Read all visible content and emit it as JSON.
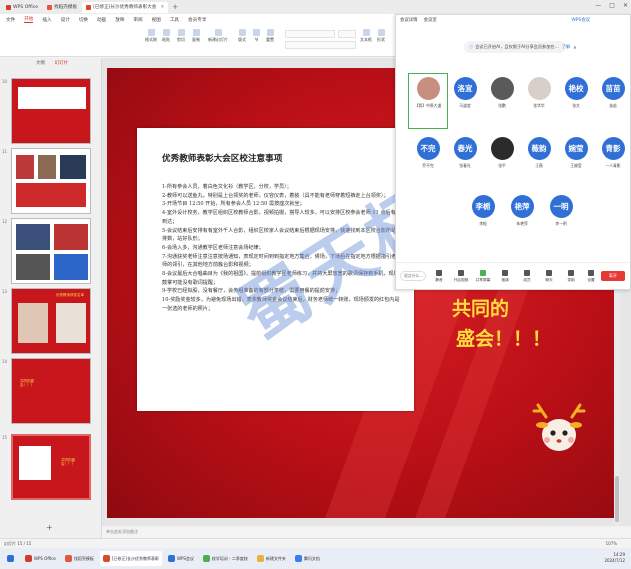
{
  "titlebar": {
    "tabs": [
      {
        "label": "WPS Office",
        "color": "#d23b2e"
      },
      {
        "label": "找稻壳模板",
        "color": "#e8553c"
      },
      {
        "label": "[已修正]长沙优秀教师表彰大会",
        "color": "#d84b2a"
      }
    ],
    "new_tab": "+",
    "controls": [
      "—",
      "□",
      "✕"
    ]
  },
  "ribbon": {
    "menu": [
      "文件",
      "开始",
      "插入",
      "设计",
      "切换",
      "动画",
      "放映",
      "审阅",
      "视图",
      "工具",
      "会员专享"
    ],
    "active_menu": "开始",
    "buttons": [
      "格式刷",
      "粘贴",
      "剪切",
      "复制",
      "新建幻灯片",
      "版式",
      "节",
      "重置",
      "文本框",
      "形状",
      "排列"
    ]
  },
  "leftpanel": {
    "tabs": [
      "大纲",
      "幻灯片"
    ],
    "active_tab": "幻灯片",
    "slides": [
      {
        "num": "10",
        "label": ""
      },
      {
        "num": "11",
        "label": ""
      },
      {
        "num": "12",
        "label": ""
      },
      {
        "num": "13",
        "label": "优秀教师获奖名单"
      },
      {
        "num": "14",
        "label": "共同的盛会！！！"
      },
      {
        "num": "15",
        "label": "共同的盛会！！！"
      }
    ],
    "add_label": "+"
  },
  "slide": {
    "title": "优秀教师表彰大会区校注意事项",
    "notice": [
      "1-所有参会人员，着白色文化衫（教学区，分校，学员）；",
      "2-教师可以送鱼丸，特别是上台领奖的老师，仪容仪表，着装（具不能有老师穿着短裤走上台领奖）；",
      "3-开场节目 12:50 开始，所有参会人员 12:50 需按座次就坐；",
      "4-室外设计校务，教学区组织区校教师合影，视频拍摄，搭导人较多，可以安排区校参会老师 11 点后有到达；",
      "5-会议结束后安排有有室外千人合影，组织区校家人会议结束后根据现场安排，快速找到本区校合影所站排数，站好队形；",
      "6-会场入多，沟通教学区老师注意会场纪律；",
      "7-沟通获奖老师注意注意按场通知，表现定时间到到指定地方集合，候场，下场后在指定地方根据指引老师的领引，在其他地方前簇台影和视频；",
      "8-会议最后大合唱曲目为《我的祖国》，提前组织教学区老师练习，并将大屏放宽的歌词保存到手机，现场鼓掌可能没有歌词提醒；",
      "9-学校已经拟股，没有餐厅，会务组准备的有部分茶歇，需要用餐的提前安排；",
      "10-奖励奖金较多，为避免现场出错，表奖教师奖金会议结束后，财务老师统一转账，现场颁发的红包内是一张选的老师的照片；"
    ],
    "watermark": "蜀天杯",
    "slogan_line1": "共同的",
    "slogan_line2": "盛会！！！"
  },
  "notes_placeholder": "单击此处添加备注",
  "meeting": {
    "top": [
      "会议详情",
      "会议室",
      "WPS会议"
    ],
    "banner_text": "会议已开启AI，且仅限于AI分享会员参加在…",
    "banner_link": "了解",
    "participants": [
      {
        "avatar_text": "",
        "name": "【我】中原大道",
        "color": "#c98f7e",
        "photo": true
      },
      {
        "avatar_text": "洛宜",
        "name": "马道谊",
        "color": "#2f6fd6"
      },
      {
        "avatar_text": "",
        "name": "张鹏",
        "color": "#5a5a5a",
        "photo": true
      },
      {
        "avatar_text": "",
        "name": "张华华",
        "color": "#d7cfc8",
        "photo": true
      },
      {
        "avatar_text": "艳校",
        "name": "张文",
        "color": "#2f6fd6"
      },
      {
        "avatar_text": "苗苗",
        "name": "苗苗",
        "color": "#2f6fd6"
      },
      {
        "avatar_text": "不完",
        "name": "乔不完",
        "color": "#2f6fd6"
      },
      {
        "avatar_text": "春光",
        "name": "张春光",
        "color": "#2f6fd6"
      },
      {
        "avatar_text": "",
        "name": "张平",
        "color": "#2b2b2b",
        "photo": true
      },
      {
        "avatar_text": "薇韵",
        "name": "王薇",
        "color": "#2f6fd6"
      },
      {
        "avatar_text": "婉莹",
        "name": "王婉莹",
        "color": "#2f6fd6"
      },
      {
        "avatar_text": "青影",
        "name": "一人青影",
        "color": "#2f6fd6"
      },
      {
        "avatar_text": "李栀",
        "name": "李栀",
        "color": "#2f6fd6"
      },
      {
        "avatar_text": "艳萍",
        "name": "朱艳萍",
        "color": "#2f6fd6"
      },
      {
        "avatar_text": "一明",
        "name": "李一明",
        "color": "#2f6fd6"
      }
    ],
    "speak_label": "说点什么…",
    "controls": [
      "静音",
      "开启视频",
      "共享屏幕",
      "邀请",
      "成员",
      "聊天",
      "录制",
      "设置"
    ],
    "leave_label": "离开"
  },
  "statusbar": {
    "left": "幻灯片 15 / 15",
    "zoom": "107%"
  },
  "taskbar": {
    "items": [
      {
        "label": "",
        "color": "#2f6fd6"
      },
      {
        "label": "WPS Office",
        "color": "#d23b2e"
      },
      {
        "label": "找稻壳模板",
        "color": "#e8553c"
      },
      {
        "label": "[已修正]长沙优秀教师表彰",
        "color": "#d84b2a"
      },
      {
        "label": "WPS会议",
        "color": "#2f6fd6"
      },
      {
        "label": "校学培训 - 二季度校",
        "color": "#4caf50"
      },
      {
        "label": "新建文件夹",
        "color": "#e6b33a"
      },
      {
        "label": "腾讯文档",
        "color": "#3d7bf0"
      }
    ],
    "time": "14:29",
    "date": "2024/7/12"
  }
}
